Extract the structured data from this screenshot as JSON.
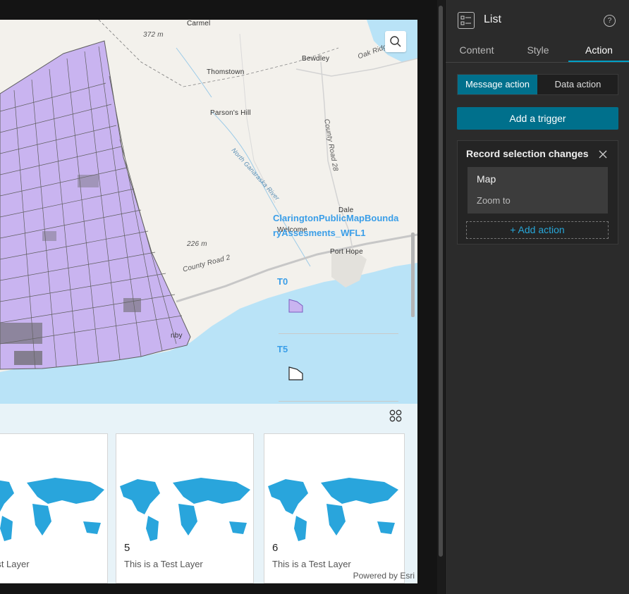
{
  "map": {
    "labels": {
      "carmel": "Carmel",
      "elev1": "372 m",
      "bewdley": "Bewdley",
      "oak_ridge": "Oak Ridge",
      "thomstown": "Thomstown",
      "parsons_hill": "Parson's Hill",
      "county_road_28": "County Road 28",
      "river": "North Ganaraska River",
      "dale": "Dale",
      "welcome": "Welcome",
      "port_hope": "Port Hope",
      "elev2": "226 m",
      "county_road_2": "County Road 2",
      "nby": "nby"
    },
    "search_icon": "search-icon",
    "colors": {
      "water": "#b9e3f7",
      "land": "#f2f0eb",
      "parcels": "#c9b4f0",
      "parcel_lines": "#5e5e5e"
    }
  },
  "legend": {
    "layer_title": "ClaringtonPublicMapBoundaryAssesments_WFL1",
    "items": [
      {
        "label": "T0",
        "color": "#c9b4f0"
      },
      {
        "label": "T5",
        "color": "#ffffff"
      }
    ]
  },
  "list": {
    "toggle_icon": "grid-layout-icon",
    "cards": [
      {
        "number": "",
        "subtitle": "is a Test Layer"
      },
      {
        "number": "5",
        "subtitle": "This is a Test Layer"
      },
      {
        "number": "6",
        "subtitle": "This is a Test Layer"
      }
    ],
    "powered_by": "Powered by Esri"
  },
  "panel": {
    "title": "List",
    "help_glyph": "?",
    "tabs": [
      {
        "label": "Content",
        "active": false
      },
      {
        "label": "Style",
        "active": false
      },
      {
        "label": "Action",
        "active": true
      }
    ],
    "segments": {
      "message": "Message action",
      "data": "Data action"
    },
    "add_trigger": "Add a trigger",
    "trigger": {
      "title": "Record selection changes",
      "target": "Map",
      "action": "Zoom to",
      "add_action": "+ Add action"
    }
  }
}
